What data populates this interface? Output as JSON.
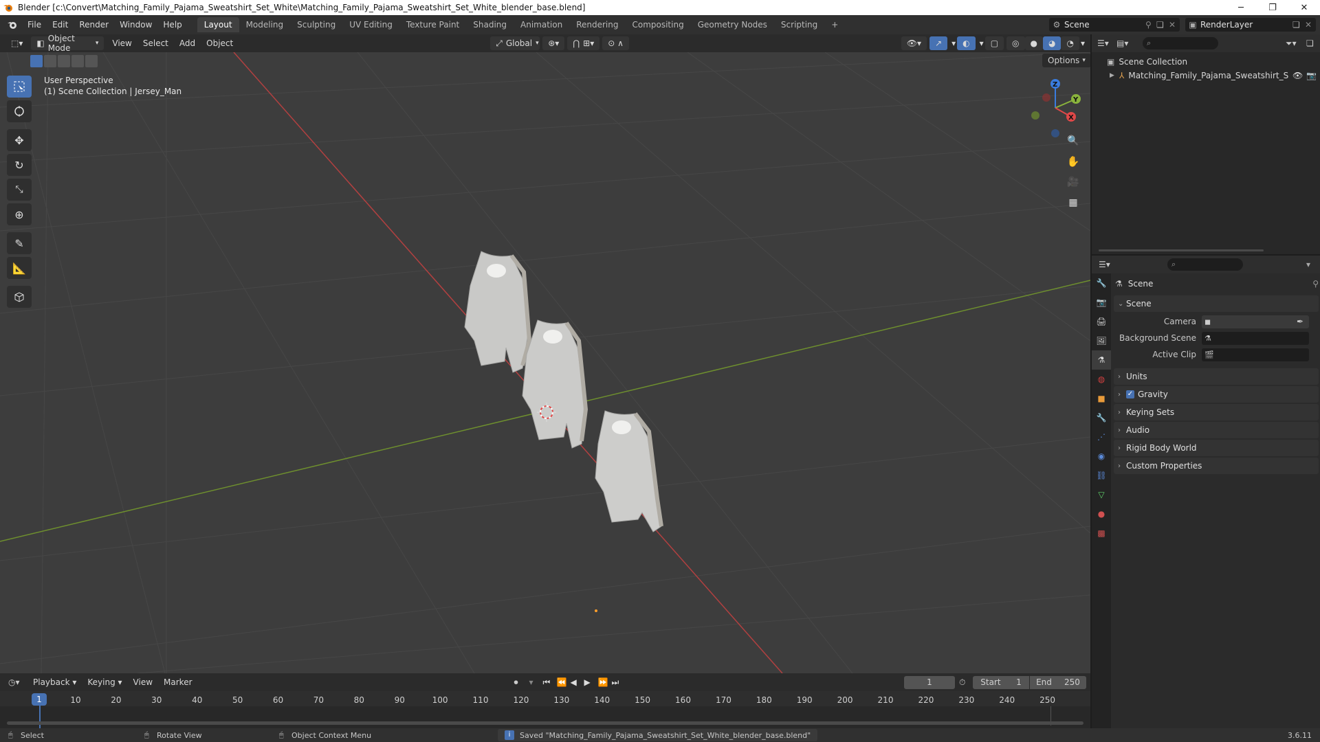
{
  "window": {
    "title": "Blender [c:\\Convert\\Matching_Family_Pajama_Sweatshirt_Set_White\\Matching_Family_Pajama_Sweatshirt_Set_White_blender_base.blend]",
    "minimize": "─",
    "maximize": "❐",
    "close": "✕"
  },
  "menu": [
    "File",
    "Edit",
    "Render",
    "Window",
    "Help"
  ],
  "workspaces": [
    "Layout",
    "Modeling",
    "Sculpting",
    "UV Editing",
    "Texture Paint",
    "Shading",
    "Animation",
    "Rendering",
    "Compositing",
    "Geometry Nodes",
    "Scripting"
  ],
  "workspace_add": "+",
  "active_workspace": "Layout",
  "scene_selector": {
    "value": "Scene"
  },
  "view_layer_selector": {
    "value": "RenderLayer"
  },
  "viewport_header": {
    "mode": "Object Mode",
    "menus": [
      "View",
      "Select",
      "Add",
      "Object"
    ],
    "orientation": "Global",
    "options": "Options"
  },
  "viewport": {
    "perspective": "User Perspective",
    "context": "(1) Scene Collection | Jersey_Man",
    "gizmo_axes": {
      "z": "Z",
      "y": "Y",
      "x": "X"
    }
  },
  "outliner": {
    "root": "Scene Collection",
    "items": [
      {
        "label": "Matching_Family_Pajama_Sweatshirt_S"
      }
    ]
  },
  "properties": {
    "header_title": "Scene",
    "panels": {
      "scene": {
        "title": "Scene",
        "camera_label": "Camera",
        "background_label": "Background Scene",
        "clip_label": "Active Clip"
      },
      "collapsed": [
        "Units",
        "Gravity",
        "Keying Sets",
        "Audio",
        "Rigid Body World",
        "Custom Properties"
      ]
    },
    "gravity_checked": true
  },
  "timeline": {
    "menus": [
      "Playback",
      "Keying",
      "View",
      "Marker"
    ],
    "current_frame": "1",
    "start_label": "Start",
    "start_value": "1",
    "end_label": "End",
    "end_value": "250",
    "ticks": [
      "1",
      "10",
      "20",
      "30",
      "40",
      "50",
      "60",
      "70",
      "80",
      "90",
      "100",
      "110",
      "120",
      "130",
      "140",
      "150",
      "160",
      "170",
      "180",
      "190",
      "200",
      "210",
      "220",
      "230",
      "240",
      "250"
    ]
  },
  "statusbar": {
    "select": "Select",
    "rotate": "Rotate View",
    "context_menu": "Object Context Menu",
    "message": "Saved \"Matching_Family_Pajama_Sweatshirt_Set_White_blender_base.blend\"",
    "version": "3.6.11"
  },
  "colors": {
    "accent": "#4772b3",
    "x_axis": "#e04848",
    "y_axis": "#8ab43c",
    "z_axis": "#3a7de0",
    "viewport_bg": "#3d3d3d"
  }
}
